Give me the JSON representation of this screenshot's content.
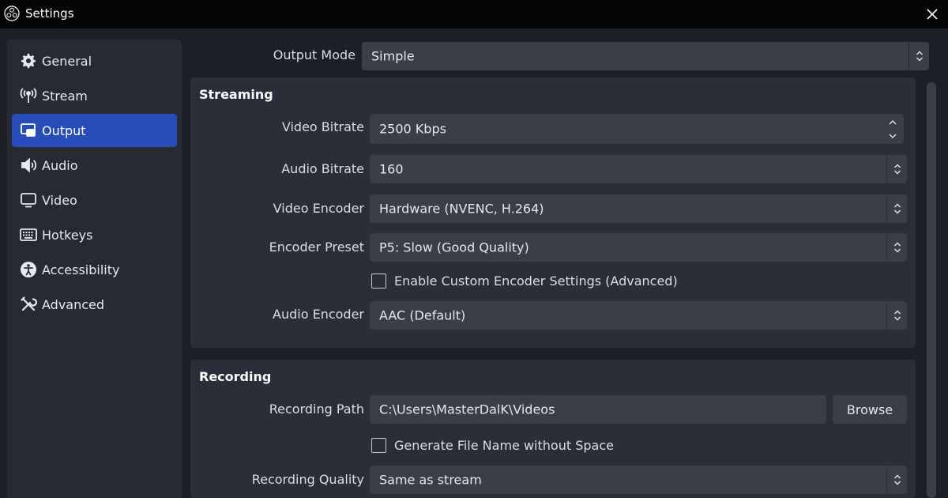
{
  "window": {
    "title": "Settings"
  },
  "sidebar": {
    "items": [
      {
        "label": "General",
        "icon": "gear-icon",
        "active": false
      },
      {
        "label": "Stream",
        "icon": "antenna-icon",
        "active": false
      },
      {
        "label": "Output",
        "icon": "output-icon",
        "active": true
      },
      {
        "label": "Audio",
        "icon": "speaker-icon",
        "active": false
      },
      {
        "label": "Video",
        "icon": "monitor-icon",
        "active": false
      },
      {
        "label": "Hotkeys",
        "icon": "keyboard-icon",
        "active": false
      },
      {
        "label": "Accessibility",
        "icon": "accessibility-icon",
        "active": false
      },
      {
        "label": "Advanced",
        "icon": "tools-icon",
        "active": false
      }
    ]
  },
  "output_mode": {
    "label": "Output Mode",
    "value": "Simple"
  },
  "streaming": {
    "title": "Streaming",
    "video_bitrate": {
      "label": "Video Bitrate",
      "value": "2500 Kbps"
    },
    "audio_bitrate": {
      "label": "Audio Bitrate",
      "value": "160"
    },
    "video_encoder": {
      "label": "Video Encoder",
      "value": "Hardware (NVENC, H.264)"
    },
    "encoder_preset": {
      "label": "Encoder Preset",
      "value": "P5: Slow (Good Quality)"
    },
    "custom_encoder_settings": {
      "label": "Enable Custom Encoder Settings (Advanced)",
      "checked": false
    },
    "audio_encoder": {
      "label": "Audio Encoder",
      "value": "AAC (Default)"
    }
  },
  "recording": {
    "title": "Recording",
    "path": {
      "label": "Recording Path",
      "value": "C:\\Users\\MasterDalK\\Videos"
    },
    "browse_label": "Browse",
    "no_space_filename": {
      "label": "Generate File Name without Space",
      "checked": false
    },
    "quality": {
      "label": "Recording Quality",
      "value": "Same as stream"
    }
  },
  "colors": {
    "accent": "#284cb8",
    "background": "#1d1f26",
    "panel": "#2b2e38",
    "input": "#3b3e49"
  }
}
